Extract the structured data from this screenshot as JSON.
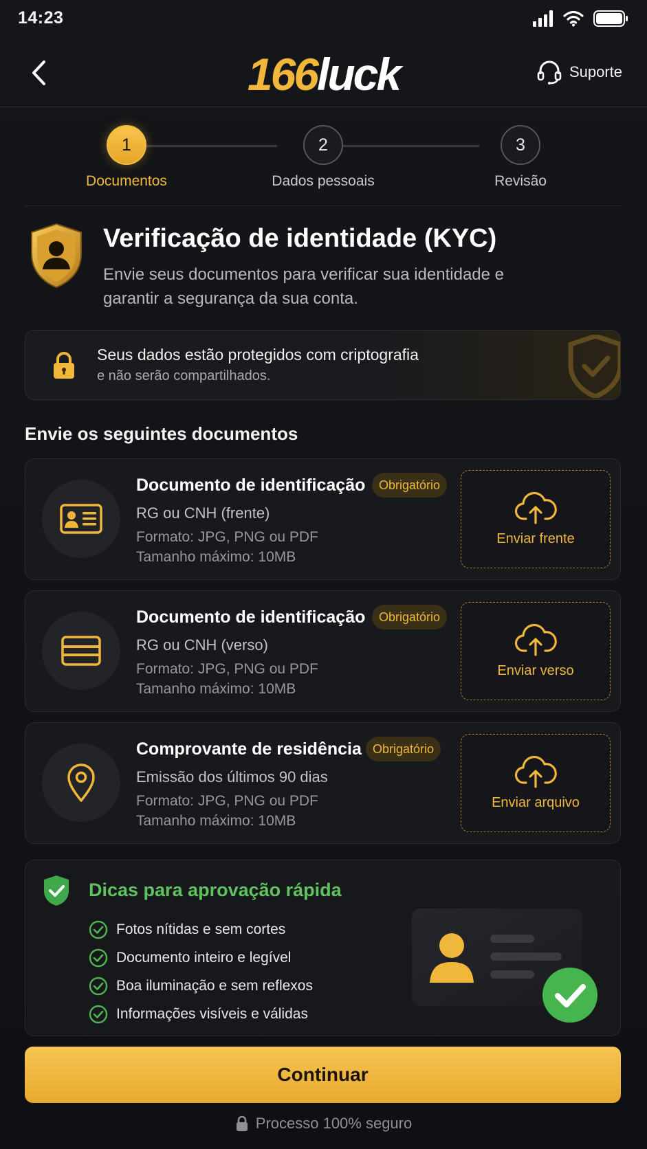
{
  "status_bar": {
    "time": "14:23"
  },
  "header": {
    "logo_number": "166",
    "logo_word": "luck",
    "support_label": "Suporte"
  },
  "stepper": {
    "steps": [
      {
        "number": "1",
        "label": "Documentos",
        "active": true
      },
      {
        "number": "2",
        "label": "Dados pessoais",
        "active": false
      },
      {
        "number": "3",
        "label": "Revisão",
        "active": false
      }
    ]
  },
  "intro": {
    "title": "Verificação de identidade (KYC)",
    "description": "Envie seus documentos para verificar sua identidade e garantir a segurança da sua conta."
  },
  "notice": {
    "line1": "Seus dados estão protegidos com criptografia",
    "line2": "e não serão compartilhados."
  },
  "documents_section": {
    "title": "Envie os seguintes documentos",
    "items": [
      {
        "icon": "id-card-icon",
        "title": "Documento de identificação",
        "badge": "Obrigatório",
        "subtitle": "RG ou CNH (frente)",
        "format": "Formato: JPG, PNG ou PDF",
        "size": "Tamanho máximo: 10MB",
        "upload_label": "Enviar frente"
      },
      {
        "icon": "card-back-icon",
        "title": "Documento de identificação",
        "badge": "Obrigatório",
        "subtitle": "RG ou CNH (verso)",
        "format": "Formato: JPG, PNG ou PDF",
        "size": "Tamanho máximo: 10MB",
        "upload_label": "Enviar verso"
      },
      {
        "icon": "location-pin-icon",
        "title": "Comprovante de residência",
        "badge": "Obrigatório",
        "subtitle": "Emissão dos últimos 90 dias",
        "format": "Formato: JPG, PNG ou PDF",
        "size": "Tamanho máximo: 10MB",
        "upload_label": "Enviar arquivo"
      }
    ]
  },
  "tips": {
    "title": "Dicas para aprovação rápida",
    "items": [
      "Fotos nítidas e sem cortes",
      "Documento inteiro e legível",
      "Boa iluminação e sem reflexos",
      "Informações visíveis e válidas"
    ]
  },
  "footer": {
    "continue_label": "Continuar",
    "secure_label": "Processo 100% seguro"
  },
  "colors": {
    "accent": "#f0b73a",
    "success": "#5fc25f",
    "background": "#121316"
  }
}
